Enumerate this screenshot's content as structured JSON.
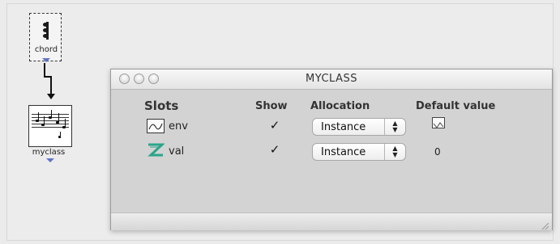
{
  "patch": {
    "chord_box": {
      "label": "chord",
      "icon": "chord-notes-icon"
    },
    "myclass_box": {
      "label": "myclass",
      "icon": "score-icon"
    }
  },
  "window": {
    "title": "MYCLASS",
    "controls": [
      "close",
      "minimize",
      "zoom"
    ],
    "headers": {
      "slots": "Slots",
      "show": "Show",
      "allocation": "Allocation",
      "default_value": "Default value"
    },
    "rows": [
      {
        "slot_icon": "bpf-curve-icon",
        "slot_name": "env",
        "show_checked": true,
        "allocation": "Instance",
        "default_value": "",
        "default_icon": "bpf-thumbnail-icon"
      },
      {
        "slot_icon": "integer-z-icon",
        "slot_name": "val",
        "show_checked": true,
        "allocation": "Instance",
        "default_value": "0",
        "default_icon": ""
      }
    ],
    "checkmark": "✓"
  },
  "colors": {
    "inlet_arrow": "#5f73c9",
    "z_icon": "#2ba58a"
  }
}
